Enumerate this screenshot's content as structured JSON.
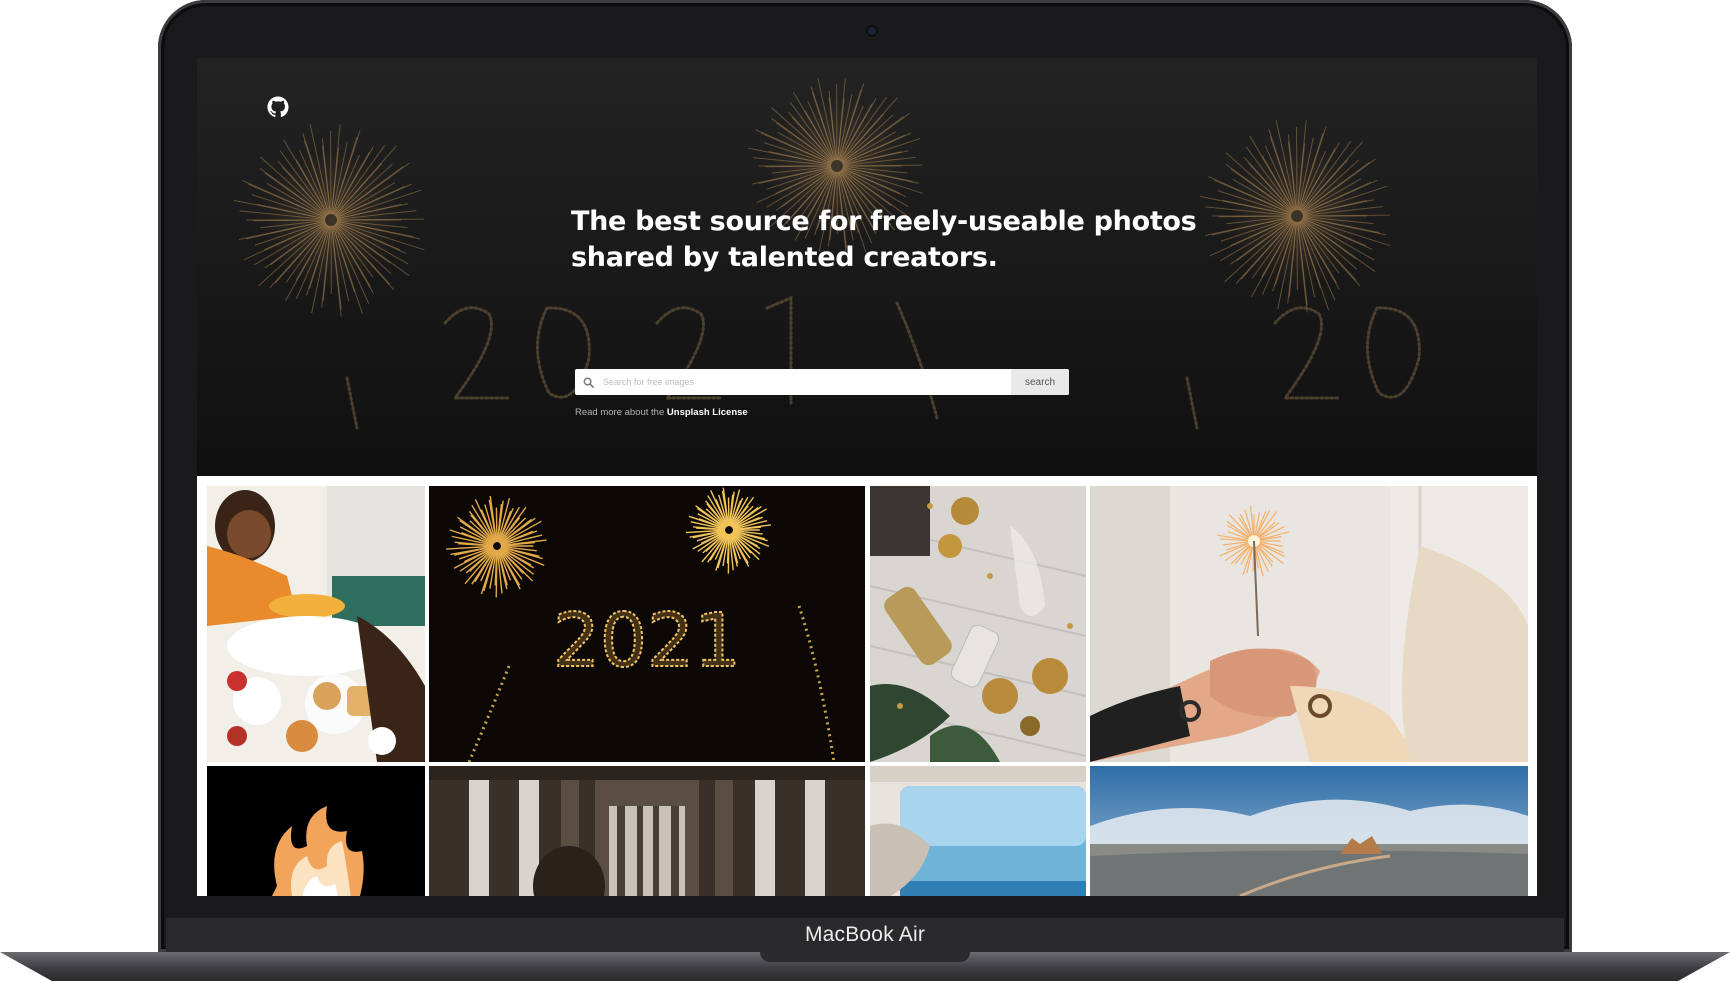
{
  "device": {
    "label": "MacBook Air"
  },
  "header": {
    "github_icon": "github-icon"
  },
  "hero": {
    "title_line1": "The best source for freely-useable photos",
    "title_line2": "shared by talented creators.",
    "background_text": "2021"
  },
  "search": {
    "placeholder": "Search for free images",
    "value": "",
    "button_label": "search",
    "icon": "search-icon"
  },
  "license": {
    "prefix": "Read more about the",
    "link_label": "Unsplash License"
  },
  "gallery": {
    "photos": [
      {
        "subject": "family breakfast with orange juice",
        "accent": "#e79a3c"
      },
      {
        "subject": "2021 sparkler writing with fireworks",
        "accent": "#d9a441"
      },
      {
        "subject": "champagne bottle and chocolates on wood",
        "accent": "#c9a04a"
      },
      {
        "subject": "hands holding a sparkler",
        "accent": "#f3b066"
      },
      {
        "subject": "flames on black",
        "accent": "#f7c58a"
      },
      {
        "subject": "pier pillars and person",
        "accent": "#6b5a4c"
      },
      {
        "subject": "van window with sea view",
        "accent": "#6fb2d6"
      },
      {
        "subject": "desert plain and rock formation",
        "accent": "#3a77b0"
      }
    ]
  },
  "colors": {
    "hero_background": "#1b1b1b",
    "firework_gold": "#b9915a",
    "text_white": "#ffffff"
  }
}
